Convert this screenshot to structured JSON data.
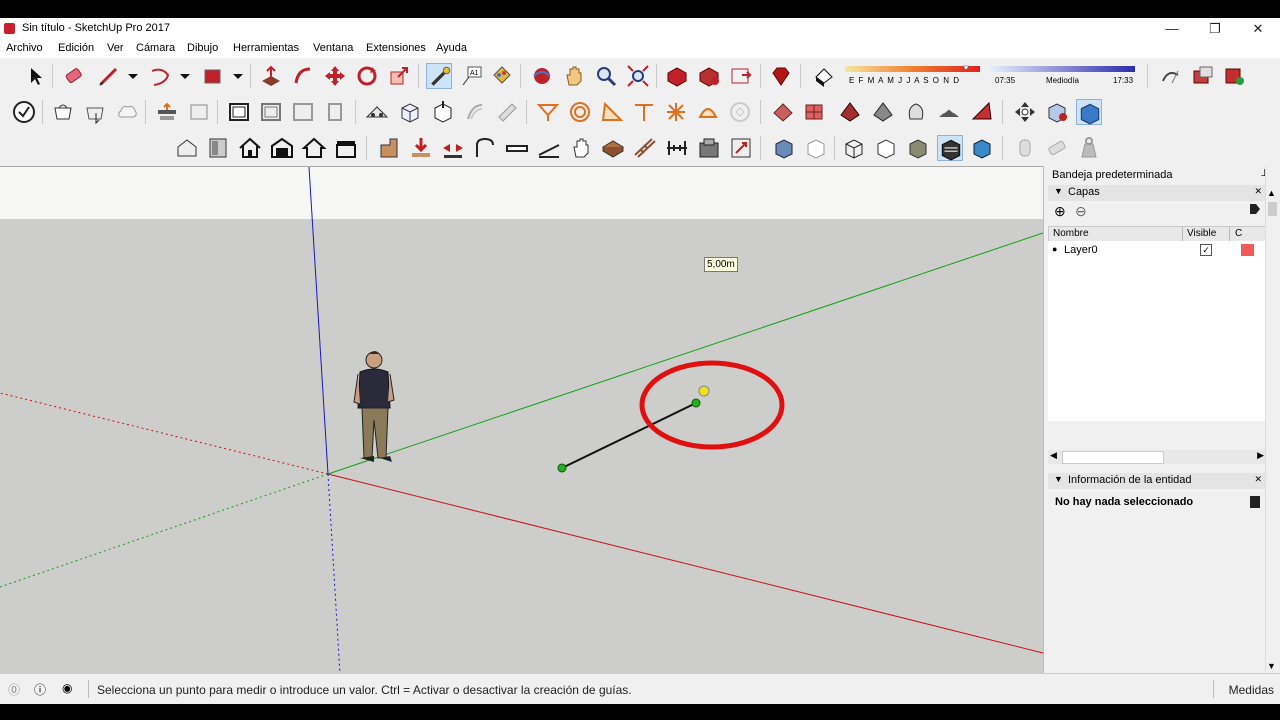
{
  "window": {
    "title": "Sin título - SketchUp Pro 2017",
    "controls": {
      "minimize": "—",
      "maximize": "❐",
      "close": "✕"
    }
  },
  "menu": [
    "Archivo",
    "Edición",
    "Ver",
    "Cámara",
    "Dibujo",
    "Herramientas",
    "Ventana",
    "Extensiones",
    "Ayuda"
  ],
  "shadow_settings": {
    "months": "E F M A M J J A S O N D",
    "time_start": "07:35",
    "time_mid": "Mediodía",
    "time_end": "17:33"
  },
  "viewport": {
    "measure_tooltip": "5,00m",
    "axis_colors": {
      "red": "#d01010",
      "green": "#14a014",
      "blue": "#1818c8"
    }
  },
  "tray": {
    "title": "Bandeja predeterminada",
    "layers_panel": {
      "title": "Capas",
      "columns": {
        "name": "Nombre",
        "visible": "Visible",
        "color": "C"
      },
      "rows": [
        {
          "name": "Layer0",
          "visible": true,
          "color": "#f25a5a"
        }
      ]
    },
    "entity_panel": {
      "title": "Información de la entidad",
      "message": "No hay nada seleccionado"
    }
  },
  "status": {
    "hint": "Selecciona un punto para medir o introduce un valor. Ctrl = Activar o desactivar la creación de guías.",
    "measurements_label": "Medidas"
  }
}
